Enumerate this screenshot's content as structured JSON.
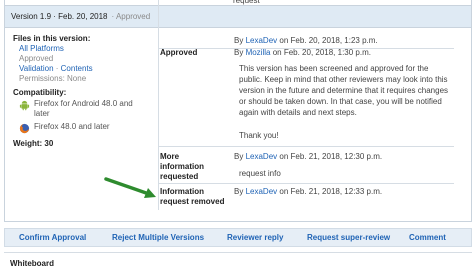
{
  "clipped_top": "request",
  "version": {
    "title": "Version 1.9 · Feb. 20, 2018",
    "status": "· Approved"
  },
  "files": {
    "heading": "Files in this version:",
    "platform_link": "All Platforms",
    "status": "Approved",
    "validation_link": "Validation",
    "separator": " · ",
    "contents_link": "Contents",
    "permissions": "Permissions: None"
  },
  "compatibility": {
    "heading": "Compatibility:",
    "items": [
      {
        "icon": "android-icon",
        "line1": "Firefox for Android 48.0 and",
        "line2": "later"
      },
      {
        "icon": "firefox-icon",
        "line1": "Firefox 48.0 and later",
        "line2": ""
      }
    ]
  },
  "weight": "Weight: 30",
  "history": [
    {
      "label": "",
      "by": "By ",
      "user": "LexaDev",
      "date": " on Feb. 20, 2018, 1:23 p.m."
    },
    {
      "label": "Approved",
      "by": "By ",
      "user": "Mozilla",
      "date": " on Feb. 20, 2018, 1:30 p.m.",
      "text": "This version has been screened and approved for the public. Keep in mind that other reviewers may look into this version in the future and determine that it requires changes or should be taken down. In that case, you will be notified again with details and next steps.",
      "thanks": "Thank you!"
    },
    {
      "label_l1": "More",
      "label_l2": "information",
      "label_l3": "requested",
      "by": "By ",
      "user": "LexaDev",
      "date": " on Feb. 21, 2018, 12:30 p.m.",
      "text": "request info"
    },
    {
      "label_l1": "Information",
      "label_l2": "request removed",
      "by": "By ",
      "user": "LexaDev",
      "date": " on Feb. 21, 2018, 12:33 p.m."
    }
  ],
  "actions": [
    "Confirm Approval",
    "Reject Multiple Versions",
    "Reviewer reply",
    "Request super-review",
    "Comment"
  ],
  "whiteboard": "Whiteboard",
  "colors": {
    "link": "#1f63b5",
    "header_bg": "#dfeaf4",
    "arrow": "#2e8b2e"
  }
}
